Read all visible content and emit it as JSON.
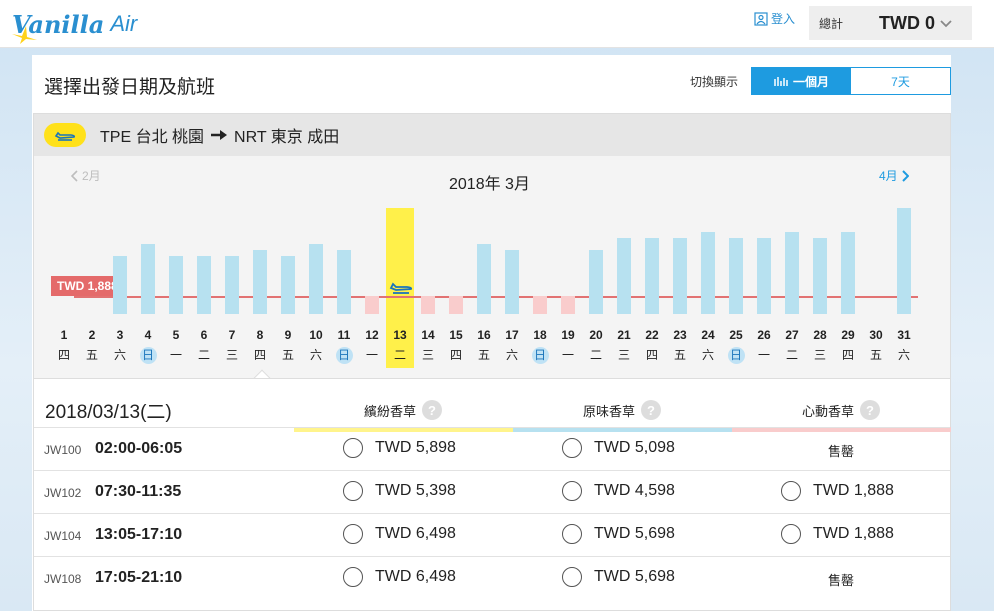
{
  "header": {
    "logo_main": "Vanilla",
    "logo_sub": "Air",
    "login_label": "登入",
    "total_label": "總計",
    "total_amount": "TWD 0"
  },
  "page": {
    "title": "選擇出發日期及航班",
    "toggle_label": "切換顯示",
    "toggle_month": "一個月",
    "toggle_week": "7天"
  },
  "route": {
    "text": "TPE 台北 桃園 ➡ NRT 東京 成田",
    "from": "TPE 台北 桃園",
    "to": "NRT 東京 成田"
  },
  "calendar": {
    "prev_month": "2月",
    "next_month": "4月",
    "month_title": "2018年 3月",
    "lowest_price": "TWD 1,888",
    "selected_day": 13,
    "days": [
      {
        "d": "1",
        "w": "四",
        "sun": false,
        "bar": "none",
        "level": 0
      },
      {
        "d": "2",
        "w": "五",
        "sun": false,
        "bar": "none",
        "level": 0
      },
      {
        "d": "3",
        "w": "六",
        "sun": false,
        "bar": "blue",
        "level": 3
      },
      {
        "d": "4",
        "w": "日",
        "sun": true,
        "bar": "blue",
        "level": 4
      },
      {
        "d": "5",
        "w": "一",
        "sun": false,
        "bar": "blue",
        "level": 3
      },
      {
        "d": "6",
        "w": "二",
        "sun": false,
        "bar": "blue",
        "level": 3
      },
      {
        "d": "7",
        "w": "三",
        "sun": false,
        "bar": "blue",
        "level": 3
      },
      {
        "d": "8",
        "w": "四",
        "sun": false,
        "bar": "blue",
        "level": 3.5
      },
      {
        "d": "9",
        "w": "五",
        "sun": false,
        "bar": "blue",
        "level": 3
      },
      {
        "d": "10",
        "w": "六",
        "sun": false,
        "bar": "blue",
        "level": 4
      },
      {
        "d": "11",
        "w": "日",
        "sun": true,
        "bar": "blue",
        "level": 3.5
      },
      {
        "d": "12",
        "w": "一",
        "sun": false,
        "bar": "pink",
        "level": 1
      },
      {
        "d": "13",
        "w": "二",
        "sun": false,
        "bar": "sel",
        "level": 1
      },
      {
        "d": "14",
        "w": "三",
        "sun": false,
        "bar": "pink",
        "level": 1
      },
      {
        "d": "15",
        "w": "四",
        "sun": false,
        "bar": "pink",
        "level": 1
      },
      {
        "d": "16",
        "w": "五",
        "sun": false,
        "bar": "blue",
        "level": 4
      },
      {
        "d": "17",
        "w": "六",
        "sun": false,
        "bar": "blue",
        "level": 3.5
      },
      {
        "d": "18",
        "w": "日",
        "sun": true,
        "bar": "pink",
        "level": 1
      },
      {
        "d": "19",
        "w": "一",
        "sun": false,
        "bar": "pink",
        "level": 1
      },
      {
        "d": "20",
        "w": "二",
        "sun": false,
        "bar": "blue",
        "level": 3.5
      },
      {
        "d": "21",
        "w": "三",
        "sun": false,
        "bar": "blue",
        "level": 4.5
      },
      {
        "d": "22",
        "w": "四",
        "sun": false,
        "bar": "blue",
        "level": 4.5
      },
      {
        "d": "23",
        "w": "五",
        "sun": false,
        "bar": "blue",
        "level": 4.5
      },
      {
        "d": "24",
        "w": "六",
        "sun": false,
        "bar": "blue",
        "level": 5
      },
      {
        "d": "25",
        "w": "日",
        "sun": true,
        "bar": "blue",
        "level": 4.5
      },
      {
        "d": "26",
        "w": "一",
        "sun": false,
        "bar": "blue",
        "level": 4.5
      },
      {
        "d": "27",
        "w": "二",
        "sun": false,
        "bar": "blue",
        "level": 5
      },
      {
        "d": "28",
        "w": "三",
        "sun": false,
        "bar": "blue",
        "level": 4.5
      },
      {
        "d": "29",
        "w": "四",
        "sun": false,
        "bar": "blue",
        "level": 5
      },
      {
        "d": "30",
        "w": "五",
        "sun": false,
        "bar": "none",
        "level": 0
      },
      {
        "d": "31",
        "w": "六",
        "sun": false,
        "bar": "blue",
        "level": 7
      }
    ]
  },
  "flights": {
    "selected_date": "2018/03/13(二)",
    "fares": [
      {
        "name": "繽紛香草",
        "color": "#fff48c"
      },
      {
        "name": "原味香草",
        "color": "#b7e1f0"
      },
      {
        "name": "心動香草",
        "color": "#f9cccc"
      }
    ],
    "rows": [
      {
        "no": "JW100",
        "time": "02:00-06:05",
        "f1": "TWD 5,898",
        "f2": "TWD 5,098",
        "f3": "售罄"
      },
      {
        "no": "JW102",
        "time": "07:30-11:35",
        "f1": "TWD 5,398",
        "f2": "TWD 4,598",
        "f3": "TWD 1,888"
      },
      {
        "no": "JW104",
        "time": "13:05-17:10",
        "f1": "TWD 6,498",
        "f2": "TWD 5,698",
        "f3": "TWD 1,888"
      },
      {
        "no": "JW108",
        "time": "17:05-21:10",
        "f1": "TWD 6,498",
        "f2": "TWD 5,698",
        "f3": "售罄"
      }
    ]
  }
}
